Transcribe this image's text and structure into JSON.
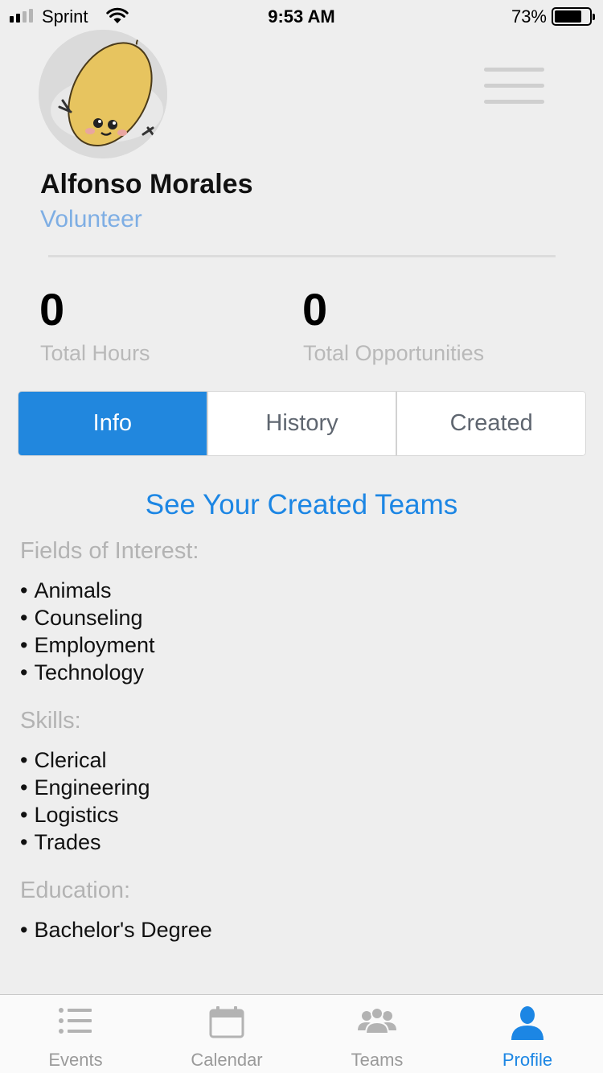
{
  "status_bar": {
    "carrier": "Sprint",
    "time": "9:53 AM",
    "battery": "73%"
  },
  "profile": {
    "name": "Alfonso Morales",
    "role": "Volunteer",
    "stats": [
      {
        "value": "0",
        "label": "Total Hours"
      },
      {
        "value": "0",
        "label": "Total Opportunities"
      }
    ]
  },
  "tabs": [
    {
      "label": "Info",
      "active": true
    },
    {
      "label": "History",
      "active": false
    },
    {
      "label": "Created",
      "active": false
    }
  ],
  "info": {
    "see_teams_link": "See Your Created Teams",
    "fields_heading": "Fields of Interest:",
    "fields": [
      "Animals",
      "Counseling",
      "Employment",
      "Technology"
    ],
    "skills_heading": "Skills:",
    "skills": [
      "Clerical",
      "Engineering",
      "Logistics",
      "Trades"
    ],
    "education_heading": "Education:",
    "education": [
      "Bachelor's Degree"
    ]
  },
  "tab_bar": [
    {
      "label": "Events",
      "icon": "list-icon",
      "active": false
    },
    {
      "label": "Calendar",
      "icon": "calendar-icon",
      "active": false
    },
    {
      "label": "Teams",
      "icon": "people-icon",
      "active": false
    },
    {
      "label": "Profile",
      "icon": "person-icon",
      "active": true
    }
  ],
  "colors": {
    "accent": "#2187de",
    "link": "#1c86e4",
    "role": "#7eaee4",
    "background": "#eeeeee"
  }
}
